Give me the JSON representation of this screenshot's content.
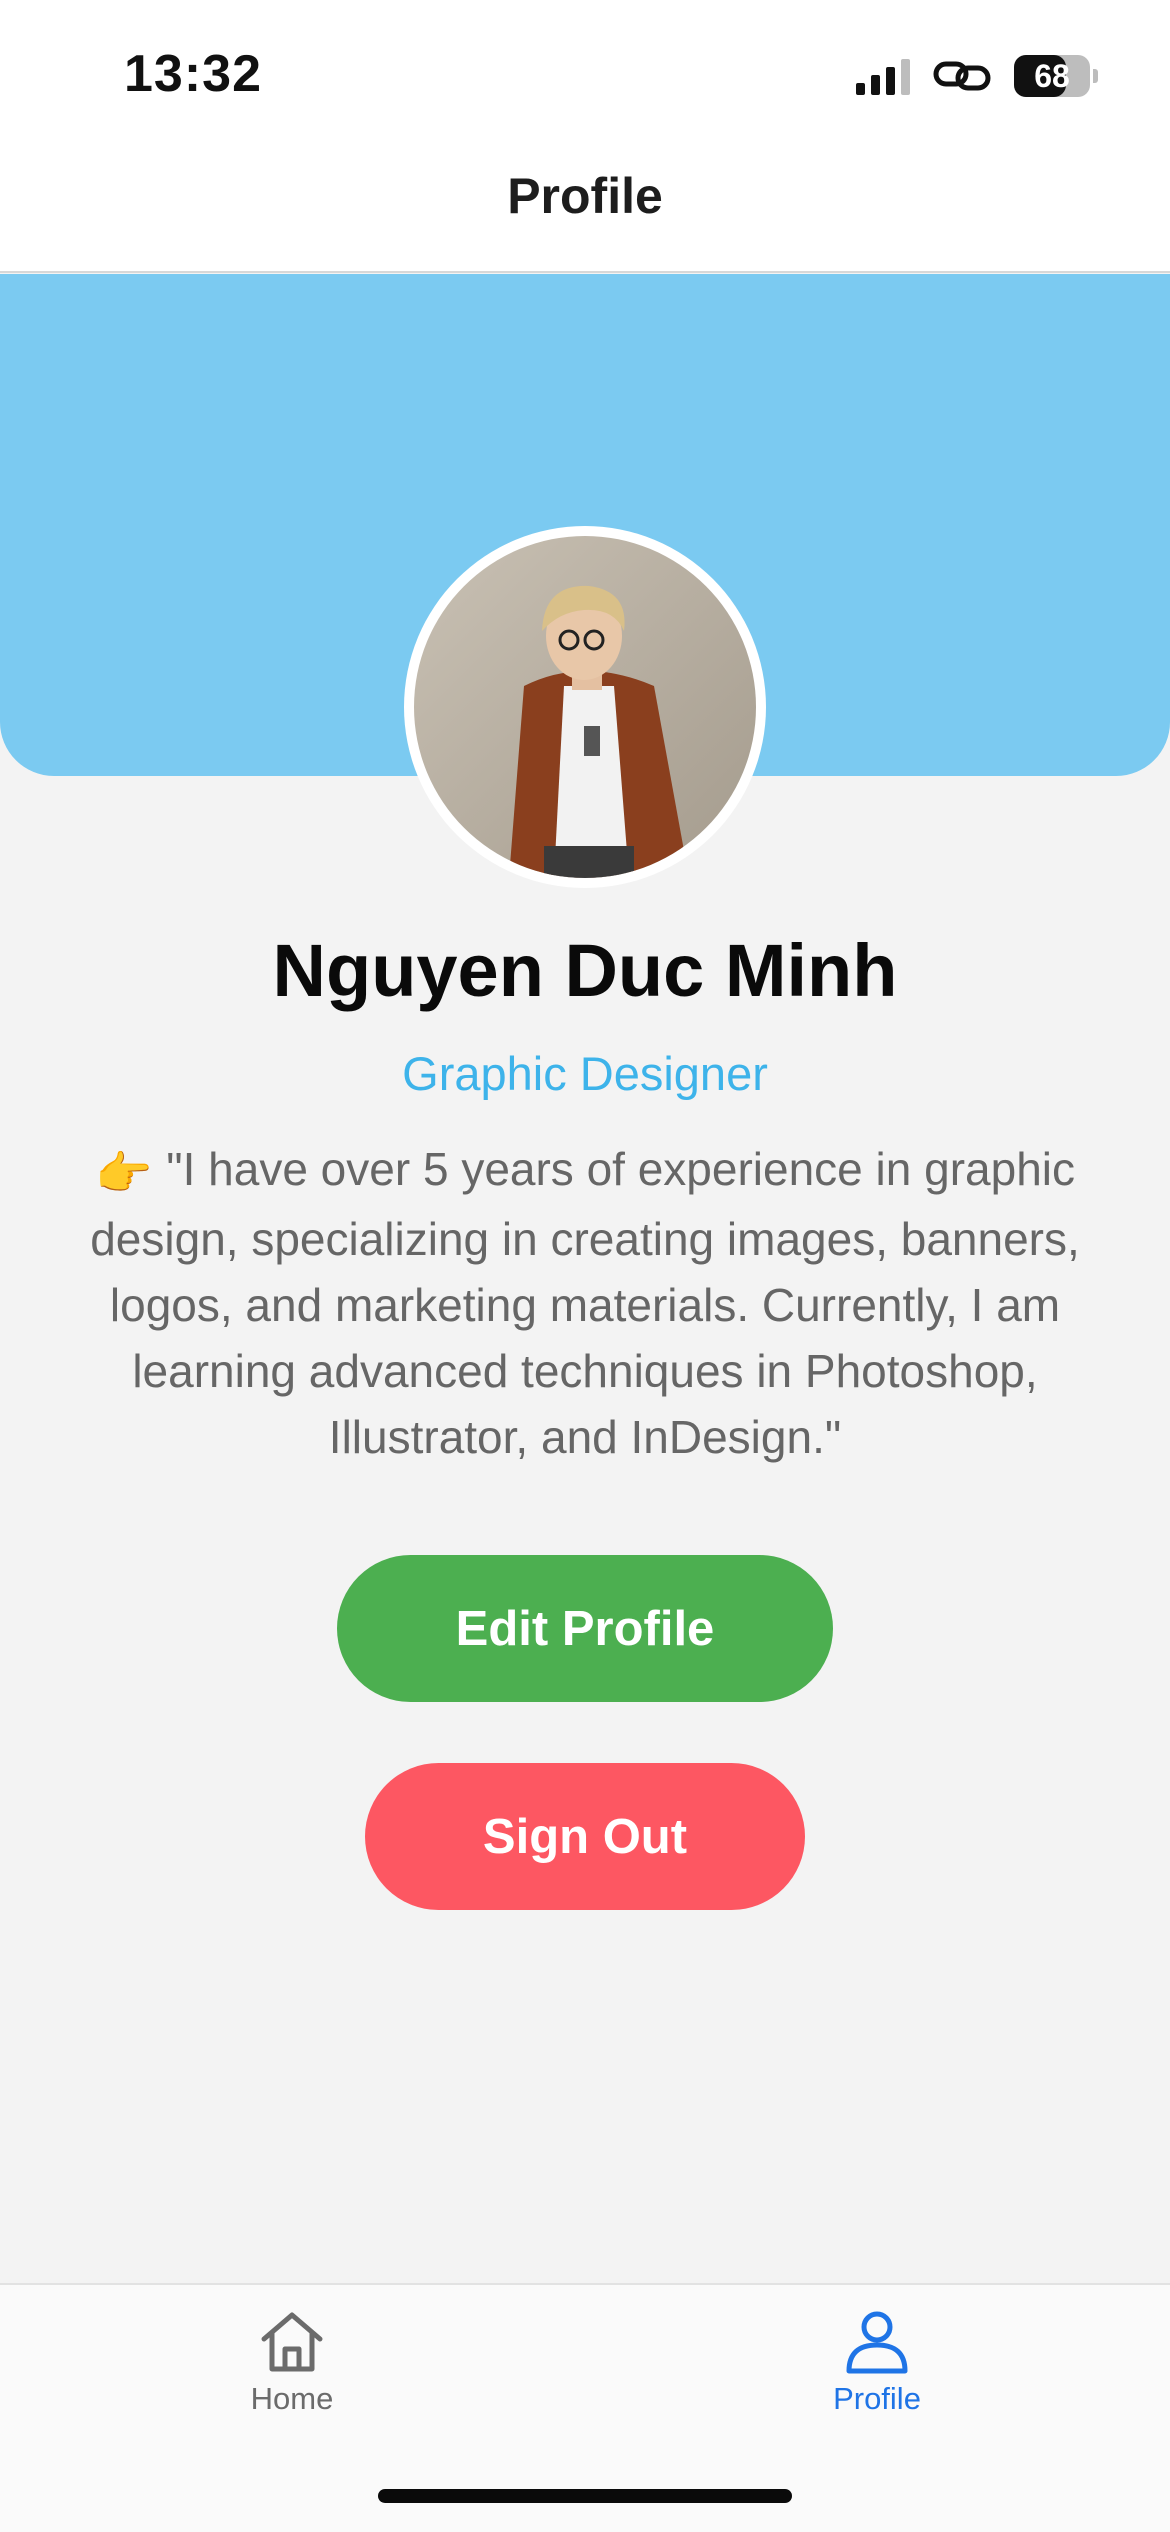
{
  "status_bar": {
    "time": "13:32",
    "battery": "68",
    "battery_level": 0.68,
    "icons": [
      "cellular-signal-icon",
      "link-icon",
      "battery-icon"
    ]
  },
  "header": {
    "title": "Profile"
  },
  "profile": {
    "name": "Nguyen Duc Minh",
    "role": "Graphic Designer",
    "bio_pointer": "👉",
    "bio": "\"I have over 5 years of experience in graphic design, specializing in creating images, banners, logos, and marketing materials. Currently, I am learning advanced techniques in Photoshop, Illustrator, and InDesign.\""
  },
  "actions": {
    "edit_label": "Edit Profile",
    "signout_label": "Sign Out"
  },
  "tab_bar": {
    "items": [
      {
        "label": "Home",
        "icon": "home-icon",
        "active": false
      },
      {
        "label": "Profile",
        "icon": "person-icon",
        "active": true
      }
    ]
  },
  "colors": {
    "cover": "#7bcaf1",
    "role": "#3db3ea",
    "edit_button": "#4caf50",
    "signout_button": "#fd5762",
    "active_tab": "#1f74e6"
  }
}
